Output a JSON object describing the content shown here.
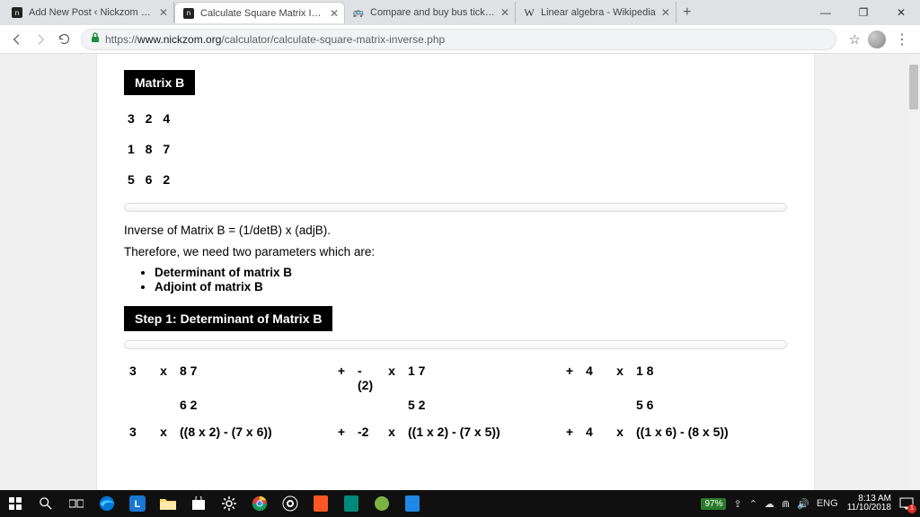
{
  "window": {
    "minimize": "—",
    "maximize": "❐",
    "close": "✕"
  },
  "tabs": [
    {
      "title": "Add New Post ‹ Nickzom Blog —",
      "close": "✕"
    },
    {
      "title": "Calculate Square Matrix Inverse",
      "close": "✕"
    },
    {
      "title": "Compare and buy bus tickets on",
      "close": "✕"
    },
    {
      "title": "Linear algebra - Wikipedia",
      "close": "✕"
    }
  ],
  "newtab": "+",
  "addr": {
    "url_prefix": "https://",
    "url_host": "www.nickzom.org",
    "url_path": "/calculator/calculate-square-matrix-inverse.php",
    "star": "☆",
    "kebab": "⋮"
  },
  "page": {
    "matrix_label": "Matrix B",
    "matrix_rows": [
      "3 2 4",
      "1 8 7",
      "5 6 2"
    ],
    "inverse_line": "Inverse of Matrix B = (1/detB) x (adjB).",
    "therefore_line": "Therefore, we need two parameters which are:",
    "needs": [
      "Determinant of matrix B",
      "Adjoint of matrix B"
    ],
    "step1_label": "Step 1: Determinant of Matrix B",
    "det": {
      "r1": {
        "c1": "3",
        "x1": "x",
        "m1a": "8 7",
        "p1": "+",
        "c2": "-(2)",
        "x2": "x",
        "m2a": "1 7",
        "p2": "+",
        "c3": "4",
        "x3": "x",
        "m3a": "1 8"
      },
      "r2": {
        "m1b": "6 2",
        "m2b": "5 2",
        "m3b": "5 6"
      },
      "r3": {
        "c1": "3",
        "x1": "x",
        "e1": "((8 x 2) - (7 x 6))",
        "p1": "+",
        "c2": "-2",
        "x2": "x",
        "e2": "((1 x 2) - (7 x 5))",
        "p2": "+",
        "c3": "4",
        "x3": "x",
        "e3": "((1 x 6) - (8 x 5))"
      }
    }
  },
  "taskbar": {
    "battery": "97%",
    "lang": "ENG",
    "time": "8:13 AM",
    "date": "11/10/2018",
    "notif_count": "1",
    "usb": "⇪",
    "caret": "⌃",
    "wifi": "⋒",
    "cloud": "☁",
    "vol": "🔊"
  }
}
